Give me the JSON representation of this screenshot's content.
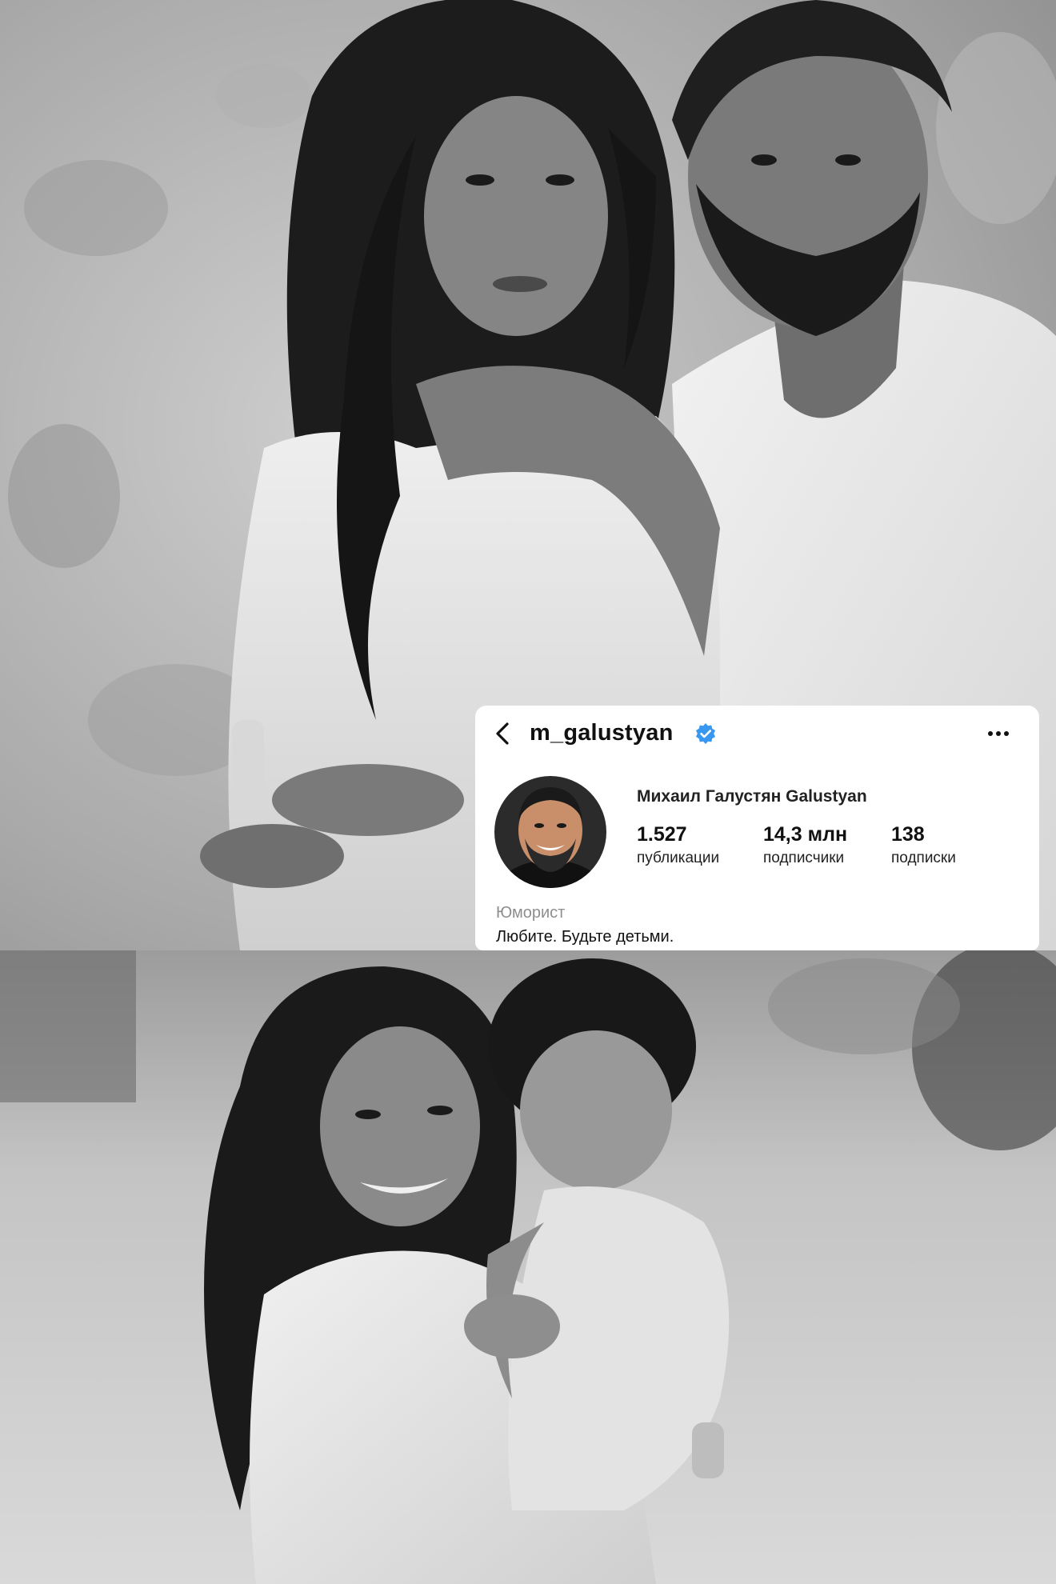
{
  "profile": {
    "username": "m_galustyan",
    "verified": true,
    "display_name": "Михаил Галустян Galustyan",
    "stats": {
      "posts": {
        "value": "1.527",
        "label": "публикации"
      },
      "followers": {
        "value": "14,3 млн",
        "label": "подписчики"
      },
      "following": {
        "value": "138",
        "label": "подписки"
      }
    },
    "category": "Юморист",
    "bio": "Любите. Будьте детьми."
  },
  "icons": {
    "back": "chevron-left-icon",
    "verified": "verified-badge-icon",
    "more": "more-horizontal-icon"
  },
  "colors": {
    "verified_badge": "#3897f0",
    "card_background": "#ffffff",
    "category_text": "#8e8e8e"
  }
}
